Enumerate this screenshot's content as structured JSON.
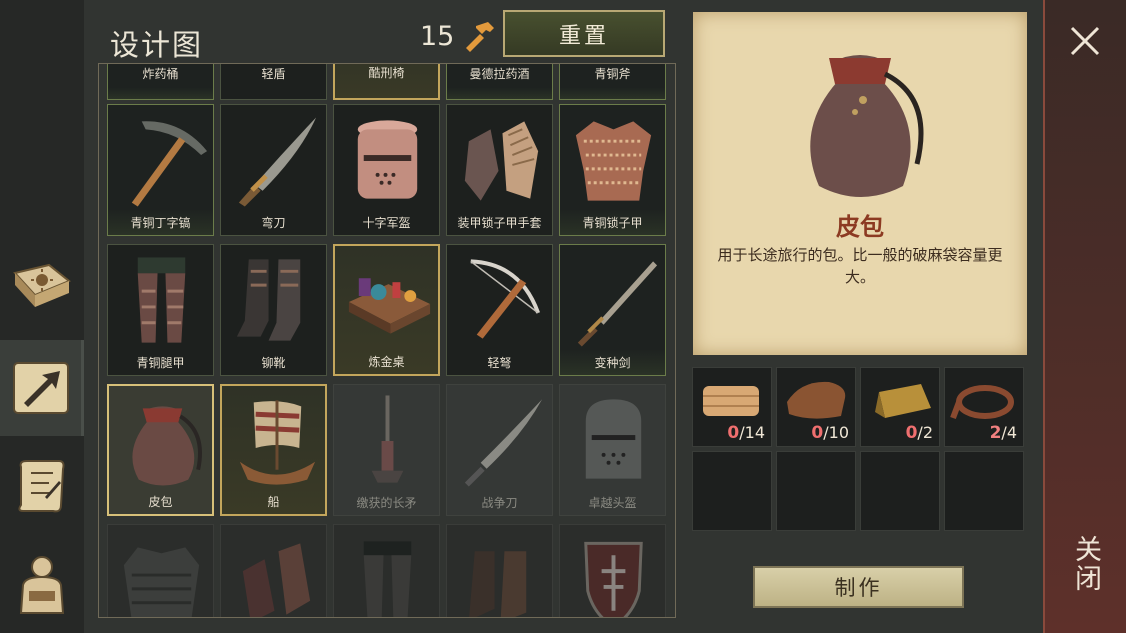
{
  "header": {
    "title": "设计图",
    "points": "15",
    "reset_label": "重置"
  },
  "sidebar": {
    "tabs": [
      {
        "icon": "sun-book-icon"
      },
      {
        "icon": "arrow-up-icon"
      },
      {
        "icon": "scroll-icon"
      },
      {
        "icon": "backpack-icon"
      }
    ]
  },
  "grid": {
    "row0": [
      "炸药桶",
      "轻盾",
      "酷刑椅",
      "曼德拉药酒",
      "青铜斧"
    ],
    "row1": [
      "青铜丁字镐",
      "弯刀",
      "十字军盔",
      "装甲锁子甲手套",
      "青铜锁子甲"
    ],
    "row2": [
      "青铜腿甲",
      "铆靴",
      "炼金桌",
      "轻弩",
      "变种剑"
    ],
    "row3": [
      "皮包",
      "船",
      "缴获的长矛",
      "战争刀",
      "卓越头盔"
    ]
  },
  "detail": {
    "name": "皮包",
    "description": "用于长途旅行的包。比一般的破麻袋容量更大。"
  },
  "materials": [
    {
      "icon": "cloth-icon",
      "have": "0",
      "need": "/14"
    },
    {
      "icon": "leather-icon",
      "have": "0",
      "need": "/10"
    },
    {
      "icon": "ingot-icon",
      "have": "0",
      "need": "/2"
    },
    {
      "icon": "leather-strap-icon",
      "have": "2",
      "need": "/4"
    }
  ],
  "craft_label": "制作",
  "close_label": "关闭",
  "colors": {
    "accent_gold": "#c3a65c",
    "need_red": "#ef6f6f",
    "card": "#e8d7ad"
  }
}
